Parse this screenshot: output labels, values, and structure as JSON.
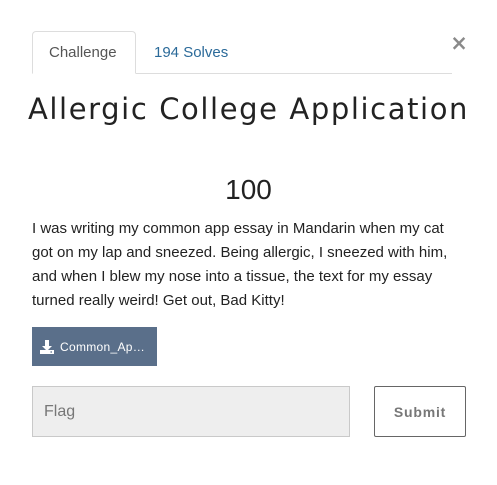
{
  "tabs": {
    "challenge_label": "Challenge",
    "solves_label": "194 Solves"
  },
  "close_glyph": "×",
  "challenge": {
    "title": "Allergic College Application",
    "points": "100",
    "description": "I was writing my common app essay in Mandarin when my cat got on my lap and sneezed. Being allergic, I sneezed with him, and when I blew my nose into a tissue, the text for my essay turned really weird! Get out, Bad Kitty!",
    "file_label": "Common_Ap…"
  },
  "form": {
    "flag_placeholder": "Flag",
    "flag_value": "",
    "submit_label": "Submit"
  },
  "colors": {
    "tab_link": "#2b6a99",
    "download_button": "#5a6f8a"
  },
  "icons": {
    "close": "close-icon",
    "download": "download-icon"
  }
}
